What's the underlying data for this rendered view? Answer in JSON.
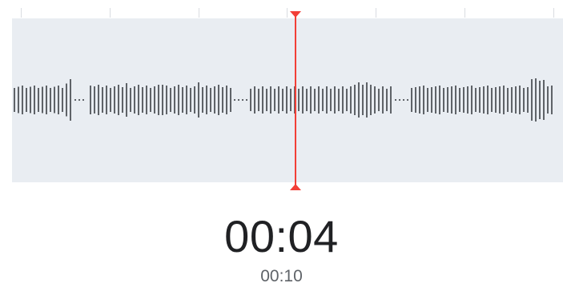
{
  "recorder": {
    "current_time": "00:04",
    "total_time": "00:10"
  },
  "colors": {
    "playhead": "#f23f37",
    "waveform": "#5f6368",
    "waveform_background": "#e9edf2",
    "tick": "#d9dce1"
  },
  "icons": {
    "playhead_top": "triangle-down-icon",
    "playhead_bottom": "triangle-up-icon"
  }
}
